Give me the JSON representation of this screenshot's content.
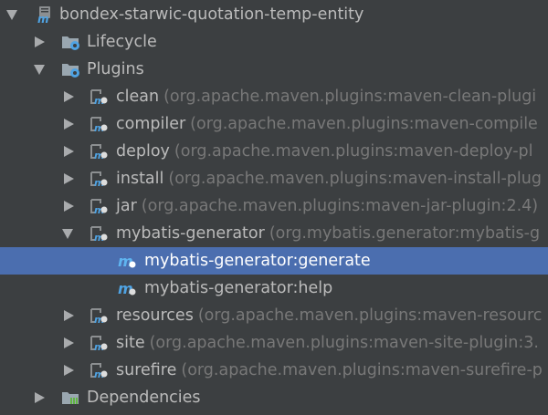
{
  "tree": {
    "project": {
      "label": "bondex-starwic-quotation-temp-entity",
      "expanded": true
    },
    "lifecycle": {
      "label": "Lifecycle",
      "expanded": false
    },
    "plugins": {
      "label": "Plugins",
      "expanded": true
    },
    "plugin_items": [
      {
        "label": "clean",
        "coords": "(org.apache.maven.plugins:maven-clean-plugi"
      },
      {
        "label": "compiler",
        "coords": "(org.apache.maven.plugins:maven-compile"
      },
      {
        "label": "deploy",
        "coords": "(org.apache.maven.plugins:maven-deploy-pl"
      },
      {
        "label": "install",
        "coords": "(org.apache.maven.plugins:maven-install-plug"
      },
      {
        "label": "jar",
        "coords": "(org.apache.maven.plugins:maven-jar-plugin:2.4)"
      },
      {
        "label": "mybatis-generator",
        "coords": "(org.mybatis.generator:mybatis-g",
        "expanded": true
      },
      {
        "label": "resources",
        "coords": "(org.apache.maven.plugins:maven-resourc"
      },
      {
        "label": "site",
        "coords": "(org.apache.maven.plugins:maven-site-plugin:3."
      },
      {
        "label": "surefire",
        "coords": "(org.apache.maven.plugins:maven-surefire-p"
      }
    ],
    "goals": [
      {
        "label": "mybatis-generator:generate",
        "selected": true
      },
      {
        "label": "mybatis-generator:help",
        "selected": false
      }
    ],
    "dependencies": {
      "label": "Dependencies",
      "expanded": false
    }
  },
  "colors": {
    "background": "#3c3f41",
    "selection": "#4b6eaf",
    "text": "#bbbbbb",
    "secondary_text": "#787878"
  }
}
